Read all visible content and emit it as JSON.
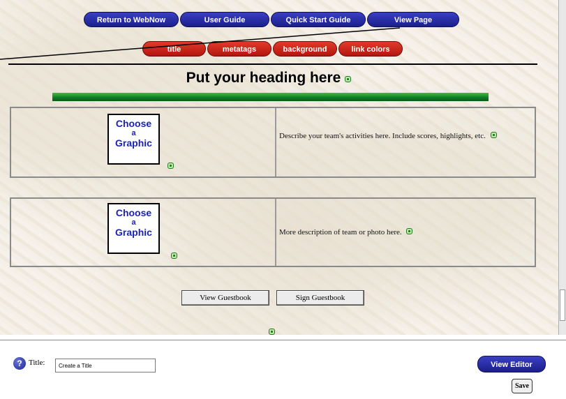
{
  "top_nav": {
    "return_label": "Return to WebNow",
    "user_guide_label": "User Guide",
    "quick_start_label": "Quick Start Guide",
    "view_page_label": "View Page"
  },
  "sub_nav": {
    "title_label": "title",
    "metatags_label": "metatags",
    "background_label": "background",
    "link_colors_label": "link colors"
  },
  "page": {
    "heading": "Put your heading here",
    "rows": [
      {
        "graphic_lines": [
          "Choose",
          "a",
          "Graphic"
        ],
        "description": "Describe your team's activities here. Include scores, highlights, etc."
      },
      {
        "graphic_lines": [
          "Choose",
          "a",
          "Graphic"
        ],
        "description": "More description of team or photo here."
      }
    ],
    "view_guestbook_label": "View Guestbook",
    "sign_guestbook_label": "Sign Guestbook"
  },
  "editor": {
    "title_label": "Title:",
    "title_value": "Create a Title",
    "view_editor_label": "View Editor",
    "save_label": "Save"
  },
  "colors": {
    "nav_blue": "#1b1f8a",
    "nav_red": "#b3160d",
    "heading_bar_green": "#0f7a22",
    "graphic_text": "#1a23b5"
  },
  "icons": {
    "edit": "edit-icon",
    "help": "help-icon"
  }
}
